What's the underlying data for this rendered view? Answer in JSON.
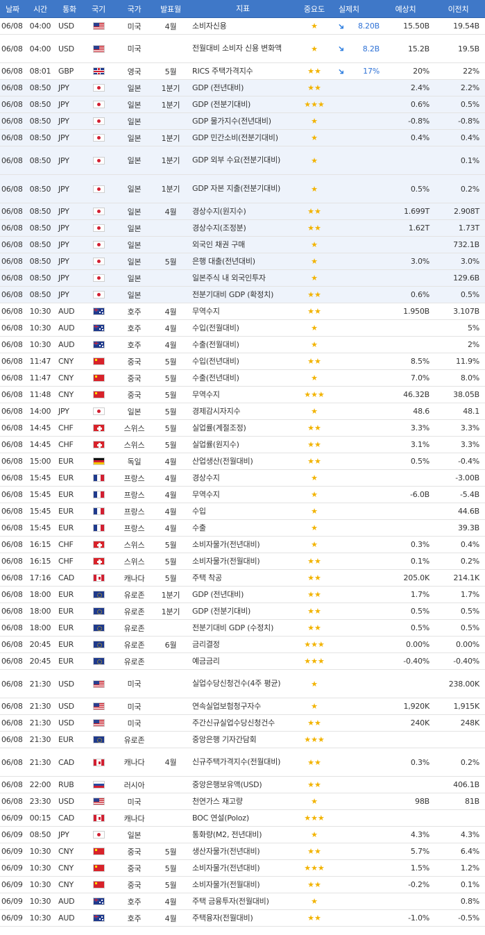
{
  "header": {
    "date": "날짜",
    "time": "시간",
    "currency": "통화",
    "flag": "국기",
    "country": "국가",
    "period": "발표월",
    "indicator": "지표",
    "importance": "중요도",
    "actual": "실제치",
    "forecast": "예상치",
    "previous": "이전치"
  },
  "rows": [
    {
      "date": "06/08",
      "time": "04:00",
      "cur": "USD",
      "flag": "us",
      "country": "미국",
      "period": "4월",
      "indicator": "소비자신용",
      "stars": "★",
      "arrow": true,
      "actual": "8.20B",
      "forecast": "15.50B",
      "previous": "19.54B"
    },
    {
      "date": "06/08",
      "time": "04:00",
      "cur": "USD",
      "flag": "us",
      "country": "미국",
      "period": "",
      "indicator": "전월대비 소비자 신용 변화액",
      "stars": "★",
      "arrow": true,
      "actual": "8.2B",
      "forecast": "15.2B",
      "previous": "19.5B"
    },
    {
      "date": "06/08",
      "time": "08:01",
      "cur": "GBP",
      "flag": "gb",
      "country": "영국",
      "period": "5월",
      "indicator": "RICS 주택가격지수",
      "stars": "★★",
      "arrow": true,
      "actual": "17%",
      "forecast": "20%",
      "previous": "22%"
    },
    {
      "date": "06/08",
      "time": "08:50",
      "cur": "JPY",
      "flag": "jp",
      "country": "일본",
      "period": "1분기",
      "indicator": "GDP (전년대비)",
      "stars": "★★",
      "arrow": false,
      "actual": "",
      "forecast": "2.4%",
      "previous": "2.2%"
    },
    {
      "date": "06/08",
      "time": "08:50",
      "cur": "JPY",
      "flag": "jp",
      "country": "일본",
      "period": "1분기",
      "indicator": "GDP (전분기대비)",
      "stars": "★★★",
      "arrow": false,
      "actual": "",
      "forecast": "0.6%",
      "previous": "0.5%"
    },
    {
      "date": "06/08",
      "time": "08:50",
      "cur": "JPY",
      "flag": "jp",
      "country": "일본",
      "period": "",
      "indicator": "GDP 물가지수(전년대비)",
      "stars": "★",
      "arrow": false,
      "actual": "",
      "forecast": "-0.8%",
      "previous": "-0.8%"
    },
    {
      "date": "06/08",
      "time": "08:50",
      "cur": "JPY",
      "flag": "jp",
      "country": "일본",
      "period": "1분기",
      "indicator": "GDP 민간소비(전분기대비)",
      "stars": "★",
      "arrow": false,
      "actual": "",
      "forecast": "0.4%",
      "previous": "0.4%"
    },
    {
      "date": "06/08",
      "time": "08:50",
      "cur": "JPY",
      "flag": "jp",
      "country": "일본",
      "period": "1분기",
      "indicator": "GDP 외부 수요(전분기대비)",
      "stars": "★",
      "arrow": false,
      "actual": "",
      "forecast": "",
      "previous": "0.1%"
    },
    {
      "date": "06/08",
      "time": "08:50",
      "cur": "JPY",
      "flag": "jp",
      "country": "일본",
      "period": "1분기",
      "indicator": "GDP 자본 지출(전분기대비)",
      "stars": "★",
      "arrow": false,
      "actual": "",
      "forecast": "0.5%",
      "previous": "0.2%"
    },
    {
      "date": "06/08",
      "time": "08:50",
      "cur": "JPY",
      "flag": "jp",
      "country": "일본",
      "period": "4월",
      "indicator": "경상수지(원지수)",
      "stars": "★★",
      "arrow": false,
      "actual": "",
      "forecast": "1.699T",
      "previous": "2.908T"
    },
    {
      "date": "06/08",
      "time": "08:50",
      "cur": "JPY",
      "flag": "jp",
      "country": "일본",
      "period": "",
      "indicator": "경상수지(조정분)",
      "stars": "★★",
      "arrow": false,
      "actual": "",
      "forecast": "1.62T",
      "previous": "1.73T"
    },
    {
      "date": "06/08",
      "time": "08:50",
      "cur": "JPY",
      "flag": "jp",
      "country": "일본",
      "period": "",
      "indicator": "외국인 채권 구매",
      "stars": "★",
      "arrow": false,
      "actual": "",
      "forecast": "",
      "previous": "732.1B"
    },
    {
      "date": "06/08",
      "time": "08:50",
      "cur": "JPY",
      "flag": "jp",
      "country": "일본",
      "period": "5월",
      "indicator": "은행 대출(전년대비)",
      "stars": "★",
      "arrow": false,
      "actual": "",
      "forecast": "3.0%",
      "previous": "3.0%"
    },
    {
      "date": "06/08",
      "time": "08:50",
      "cur": "JPY",
      "flag": "jp",
      "country": "일본",
      "period": "",
      "indicator": "일본주식 내 외국인투자",
      "stars": "★",
      "arrow": false,
      "actual": "",
      "forecast": "",
      "previous": "129.6B"
    },
    {
      "date": "06/08",
      "time": "08:50",
      "cur": "JPY",
      "flag": "jp",
      "country": "일본",
      "period": "",
      "indicator": "전분기대비 GDP (확정치)",
      "stars": "★★",
      "arrow": false,
      "actual": "",
      "forecast": "0.6%",
      "previous": "0.5%"
    },
    {
      "date": "06/08",
      "time": "10:30",
      "cur": "AUD",
      "flag": "au",
      "country": "호주",
      "period": "4월",
      "indicator": "무역수지",
      "stars": "★★",
      "arrow": false,
      "actual": "",
      "forecast": "1.950B",
      "previous": "3.107B"
    },
    {
      "date": "06/08",
      "time": "10:30",
      "cur": "AUD",
      "flag": "au",
      "country": "호주",
      "period": "4월",
      "indicator": "수입(전월대비)",
      "stars": "★",
      "arrow": false,
      "actual": "",
      "forecast": "",
      "previous": "5%"
    },
    {
      "date": "06/08",
      "time": "10:30",
      "cur": "AUD",
      "flag": "au",
      "country": "호주",
      "period": "4월",
      "indicator": "수출(전월대비)",
      "stars": "★",
      "arrow": false,
      "actual": "",
      "forecast": "",
      "previous": "2%"
    },
    {
      "date": "06/08",
      "time": "11:47",
      "cur": "CNY",
      "flag": "cn",
      "country": "중국",
      "period": "5월",
      "indicator": "수입(전년대비)",
      "stars": "★★",
      "arrow": false,
      "actual": "",
      "forecast": "8.5%",
      "previous": "11.9%"
    },
    {
      "date": "06/08",
      "time": "11:47",
      "cur": "CNY",
      "flag": "cn",
      "country": "중국",
      "period": "5월",
      "indicator": "수출(전년대비)",
      "stars": "★",
      "arrow": false,
      "actual": "",
      "forecast": "7.0%",
      "previous": "8.0%"
    },
    {
      "date": "06/08",
      "time": "11:48",
      "cur": "CNY",
      "flag": "cn",
      "country": "중국",
      "period": "5월",
      "indicator": "무역수지",
      "stars": "★★★",
      "arrow": false,
      "actual": "",
      "forecast": "46.32B",
      "previous": "38.05B"
    },
    {
      "date": "06/08",
      "time": "14:00",
      "cur": "JPY",
      "flag": "jp",
      "country": "일본",
      "period": "5월",
      "indicator": "경제감시자지수",
      "stars": "★",
      "arrow": false,
      "actual": "",
      "forecast": "48.6",
      "previous": "48.1"
    },
    {
      "date": "06/08",
      "time": "14:45",
      "cur": "CHF",
      "flag": "ch",
      "country": "스위스",
      "period": "5월",
      "indicator": "실업률(계절조정)",
      "stars": "★★",
      "arrow": false,
      "actual": "",
      "forecast": "3.3%",
      "previous": "3.3%"
    },
    {
      "date": "06/08",
      "time": "14:45",
      "cur": "CHF",
      "flag": "ch",
      "country": "스위스",
      "period": "5월",
      "indicator": "실업률(원지수)",
      "stars": "★★",
      "arrow": false,
      "actual": "",
      "forecast": "3.1%",
      "previous": "3.3%"
    },
    {
      "date": "06/08",
      "time": "15:00",
      "cur": "EUR",
      "flag": "de",
      "country": "독일",
      "period": "4월",
      "indicator": "산업생산(전월대비)",
      "stars": "★★",
      "arrow": false,
      "actual": "",
      "forecast": "0.5%",
      "previous": "-0.4%"
    },
    {
      "date": "06/08",
      "time": "15:45",
      "cur": "EUR",
      "flag": "fr",
      "country": "프랑스",
      "period": "4월",
      "indicator": "경상수지",
      "stars": "★",
      "arrow": false,
      "actual": "",
      "forecast": "",
      "previous": "-3.00B"
    },
    {
      "date": "06/08",
      "time": "15:45",
      "cur": "EUR",
      "flag": "fr",
      "country": "프랑스",
      "period": "4월",
      "indicator": "무역수지",
      "stars": "★",
      "arrow": false,
      "actual": "",
      "forecast": "-6.0B",
      "previous": "-5.4B"
    },
    {
      "date": "06/08",
      "time": "15:45",
      "cur": "EUR",
      "flag": "fr",
      "country": "프랑스",
      "period": "4월",
      "indicator": "수입",
      "stars": "★",
      "arrow": false,
      "actual": "",
      "forecast": "",
      "previous": "44.6B"
    },
    {
      "date": "06/08",
      "time": "15:45",
      "cur": "EUR",
      "flag": "fr",
      "country": "프랑스",
      "period": "4월",
      "indicator": "수출",
      "stars": "★",
      "arrow": false,
      "actual": "",
      "forecast": "",
      "previous": "39.3B"
    },
    {
      "date": "06/08",
      "time": "16:15",
      "cur": "CHF",
      "flag": "ch",
      "country": "스위스",
      "period": "5월",
      "indicator": "소비자물가(전년대비)",
      "stars": "★",
      "arrow": false,
      "actual": "",
      "forecast": "0.3%",
      "previous": "0.4%"
    },
    {
      "date": "06/08",
      "time": "16:15",
      "cur": "CHF",
      "flag": "ch",
      "country": "스위스",
      "period": "5월",
      "indicator": "소비자물가(전월대비)",
      "stars": "★★",
      "arrow": false,
      "actual": "",
      "forecast": "0.1%",
      "previous": "0.2%"
    },
    {
      "date": "06/08",
      "time": "17:16",
      "cur": "CAD",
      "flag": "ca",
      "country": "캐나다",
      "period": "5월",
      "indicator": "주택 착공",
      "stars": "★★",
      "arrow": false,
      "actual": "",
      "forecast": "205.0K",
      "previous": "214.1K"
    },
    {
      "date": "06/08",
      "time": "18:00",
      "cur": "EUR",
      "flag": "eu",
      "country": "유로존",
      "period": "1분기",
      "indicator": "GDP (전년대비)",
      "stars": "★★",
      "arrow": false,
      "actual": "",
      "forecast": "1.7%",
      "previous": "1.7%"
    },
    {
      "date": "06/08",
      "time": "18:00",
      "cur": "EUR",
      "flag": "eu",
      "country": "유로존",
      "period": "1분기",
      "indicator": "GDP (전분기대비)",
      "stars": "★★",
      "arrow": false,
      "actual": "",
      "forecast": "0.5%",
      "previous": "0.5%"
    },
    {
      "date": "06/08",
      "time": "18:00",
      "cur": "EUR",
      "flag": "eu",
      "country": "유로존",
      "period": "",
      "indicator": "전분기대비 GDP (수정치)",
      "stars": "★★",
      "arrow": false,
      "actual": "",
      "forecast": "0.5%",
      "previous": "0.5%"
    },
    {
      "date": "06/08",
      "time": "20:45",
      "cur": "EUR",
      "flag": "eu",
      "country": "유로존",
      "period": "6월",
      "indicator": "금리결정",
      "stars": "★★★",
      "arrow": false,
      "actual": "",
      "forecast": "0.00%",
      "previous": "0.00%"
    },
    {
      "date": "06/08",
      "time": "20:45",
      "cur": "EUR",
      "flag": "eu",
      "country": "유로존",
      "period": "",
      "indicator": "예금금리",
      "stars": "★★★",
      "arrow": false,
      "actual": "",
      "forecast": "-0.40%",
      "previous": "-0.40%"
    },
    {
      "date": "06/08",
      "time": "21:30",
      "cur": "USD",
      "flag": "us",
      "country": "미국",
      "period": "",
      "indicator": "실업수당신청건수(4주 평균)",
      "stars": "★",
      "arrow": false,
      "actual": "",
      "forecast": "",
      "previous": "238.00K"
    },
    {
      "date": "06/08",
      "time": "21:30",
      "cur": "USD",
      "flag": "us",
      "country": "미국",
      "period": "",
      "indicator": "연속실업보험청구자수",
      "stars": "★",
      "arrow": false,
      "actual": "",
      "forecast": "1,920K",
      "previous": "1,915K"
    },
    {
      "date": "06/08",
      "time": "21:30",
      "cur": "USD",
      "flag": "us",
      "country": "미국",
      "period": "",
      "indicator": "주간신규실업수당신청건수",
      "stars": "★★",
      "arrow": false,
      "actual": "",
      "forecast": "240K",
      "previous": "248K"
    },
    {
      "date": "06/08",
      "time": "21:30",
      "cur": "EUR",
      "flag": "eu",
      "country": "유로존",
      "period": "",
      "indicator": "중앙은행 기자간담회",
      "stars": "★★★",
      "arrow": false,
      "actual": "",
      "forecast": "",
      "previous": ""
    },
    {
      "date": "06/08",
      "time": "21:30",
      "cur": "CAD",
      "flag": "ca",
      "country": "캐나다",
      "period": "4월",
      "indicator": "신규주택가격지수(전월대비)",
      "stars": "★★",
      "arrow": false,
      "actual": "",
      "forecast": "0.3%",
      "previous": "0.2%"
    },
    {
      "date": "06/08",
      "time": "22:00",
      "cur": "RUB",
      "flag": "ru",
      "country": "러시아",
      "period": "",
      "indicator": "중앙은행보유액(USD)",
      "stars": "★★",
      "arrow": false,
      "actual": "",
      "forecast": "",
      "previous": "406.1B"
    },
    {
      "date": "06/08",
      "time": "23:30",
      "cur": "USD",
      "flag": "us",
      "country": "미국",
      "period": "",
      "indicator": "천연가스 재고량",
      "stars": "★",
      "arrow": false,
      "actual": "",
      "forecast": "98B",
      "previous": "81B"
    },
    {
      "date": "06/09",
      "time": "00:15",
      "cur": "CAD",
      "flag": "ca",
      "country": "캐나다",
      "period": "",
      "indicator": "BOC 연설(Poloz)",
      "stars": "★★★",
      "arrow": false,
      "actual": "",
      "forecast": "",
      "previous": ""
    },
    {
      "date": "06/09",
      "time": "08:50",
      "cur": "JPY",
      "flag": "jp",
      "country": "일본",
      "period": "",
      "indicator": "통화량(M2, 전년대비)",
      "stars": "★",
      "arrow": false,
      "actual": "",
      "forecast": "4.3%",
      "previous": "4.3%"
    },
    {
      "date": "06/09",
      "time": "10:30",
      "cur": "CNY",
      "flag": "cn",
      "country": "중국",
      "period": "5월",
      "indicator": "생산자물가(전년대비)",
      "stars": "★★",
      "arrow": false,
      "actual": "",
      "forecast": "5.7%",
      "previous": "6.4%"
    },
    {
      "date": "06/09",
      "time": "10:30",
      "cur": "CNY",
      "flag": "cn",
      "country": "중국",
      "period": "5월",
      "indicator": "소비자물가(전년대비)",
      "stars": "★★★",
      "arrow": false,
      "actual": "",
      "forecast": "1.5%",
      "previous": "1.2%"
    },
    {
      "date": "06/09",
      "time": "10:30",
      "cur": "CNY",
      "flag": "cn",
      "country": "중국",
      "period": "5월",
      "indicator": "소비자물가(전월대비)",
      "stars": "★★",
      "arrow": false,
      "actual": "",
      "forecast": "-0.2%",
      "previous": "0.1%"
    },
    {
      "date": "06/09",
      "time": "10:30",
      "cur": "AUD",
      "flag": "au",
      "country": "호주",
      "period": "4월",
      "indicator": "주택 금융투자(전월대비)",
      "stars": "★",
      "arrow": false,
      "actual": "",
      "forecast": "",
      "previous": "0.8%"
    },
    {
      "date": "06/09",
      "time": "10:30",
      "cur": "AUD",
      "flag": "au",
      "country": "호주",
      "period": "4월",
      "indicator": "주택융자(전월대비)",
      "stars": "★★",
      "arrow": false,
      "actual": "",
      "forecast": "-1.0%",
      "previous": "-0.5%"
    }
  ]
}
